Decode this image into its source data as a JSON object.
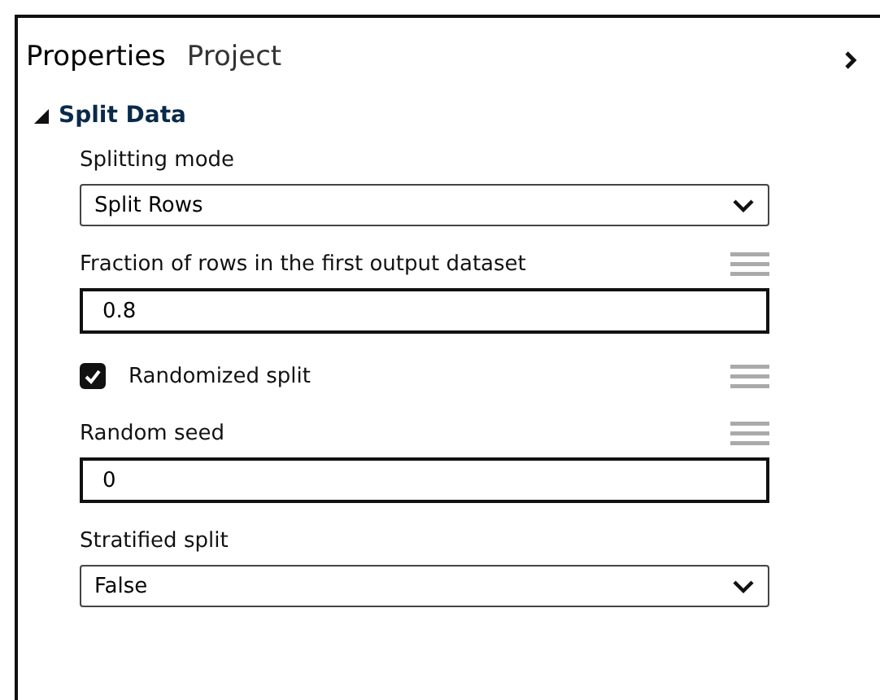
{
  "tabs": [
    {
      "label": "Properties",
      "selected": true
    },
    {
      "label": "Project",
      "selected": false
    }
  ],
  "section": {
    "title": "Split Data",
    "expanded": true
  },
  "fields": [
    {
      "kind": "dropdown",
      "label": "Splitting mode",
      "value": "Split Rows"
    },
    {
      "kind": "text",
      "label": "Fraction of rows in the first output dataset",
      "value": "0.8",
      "handle": true
    },
    {
      "kind": "checkbox",
      "label": "Randomized split",
      "checked": true,
      "handle": true
    },
    {
      "kind": "text",
      "label": "Random seed",
      "value": "0",
      "handle": true
    },
    {
      "kind": "dropdown",
      "label": "Stratified split",
      "value": "False"
    }
  ]
}
